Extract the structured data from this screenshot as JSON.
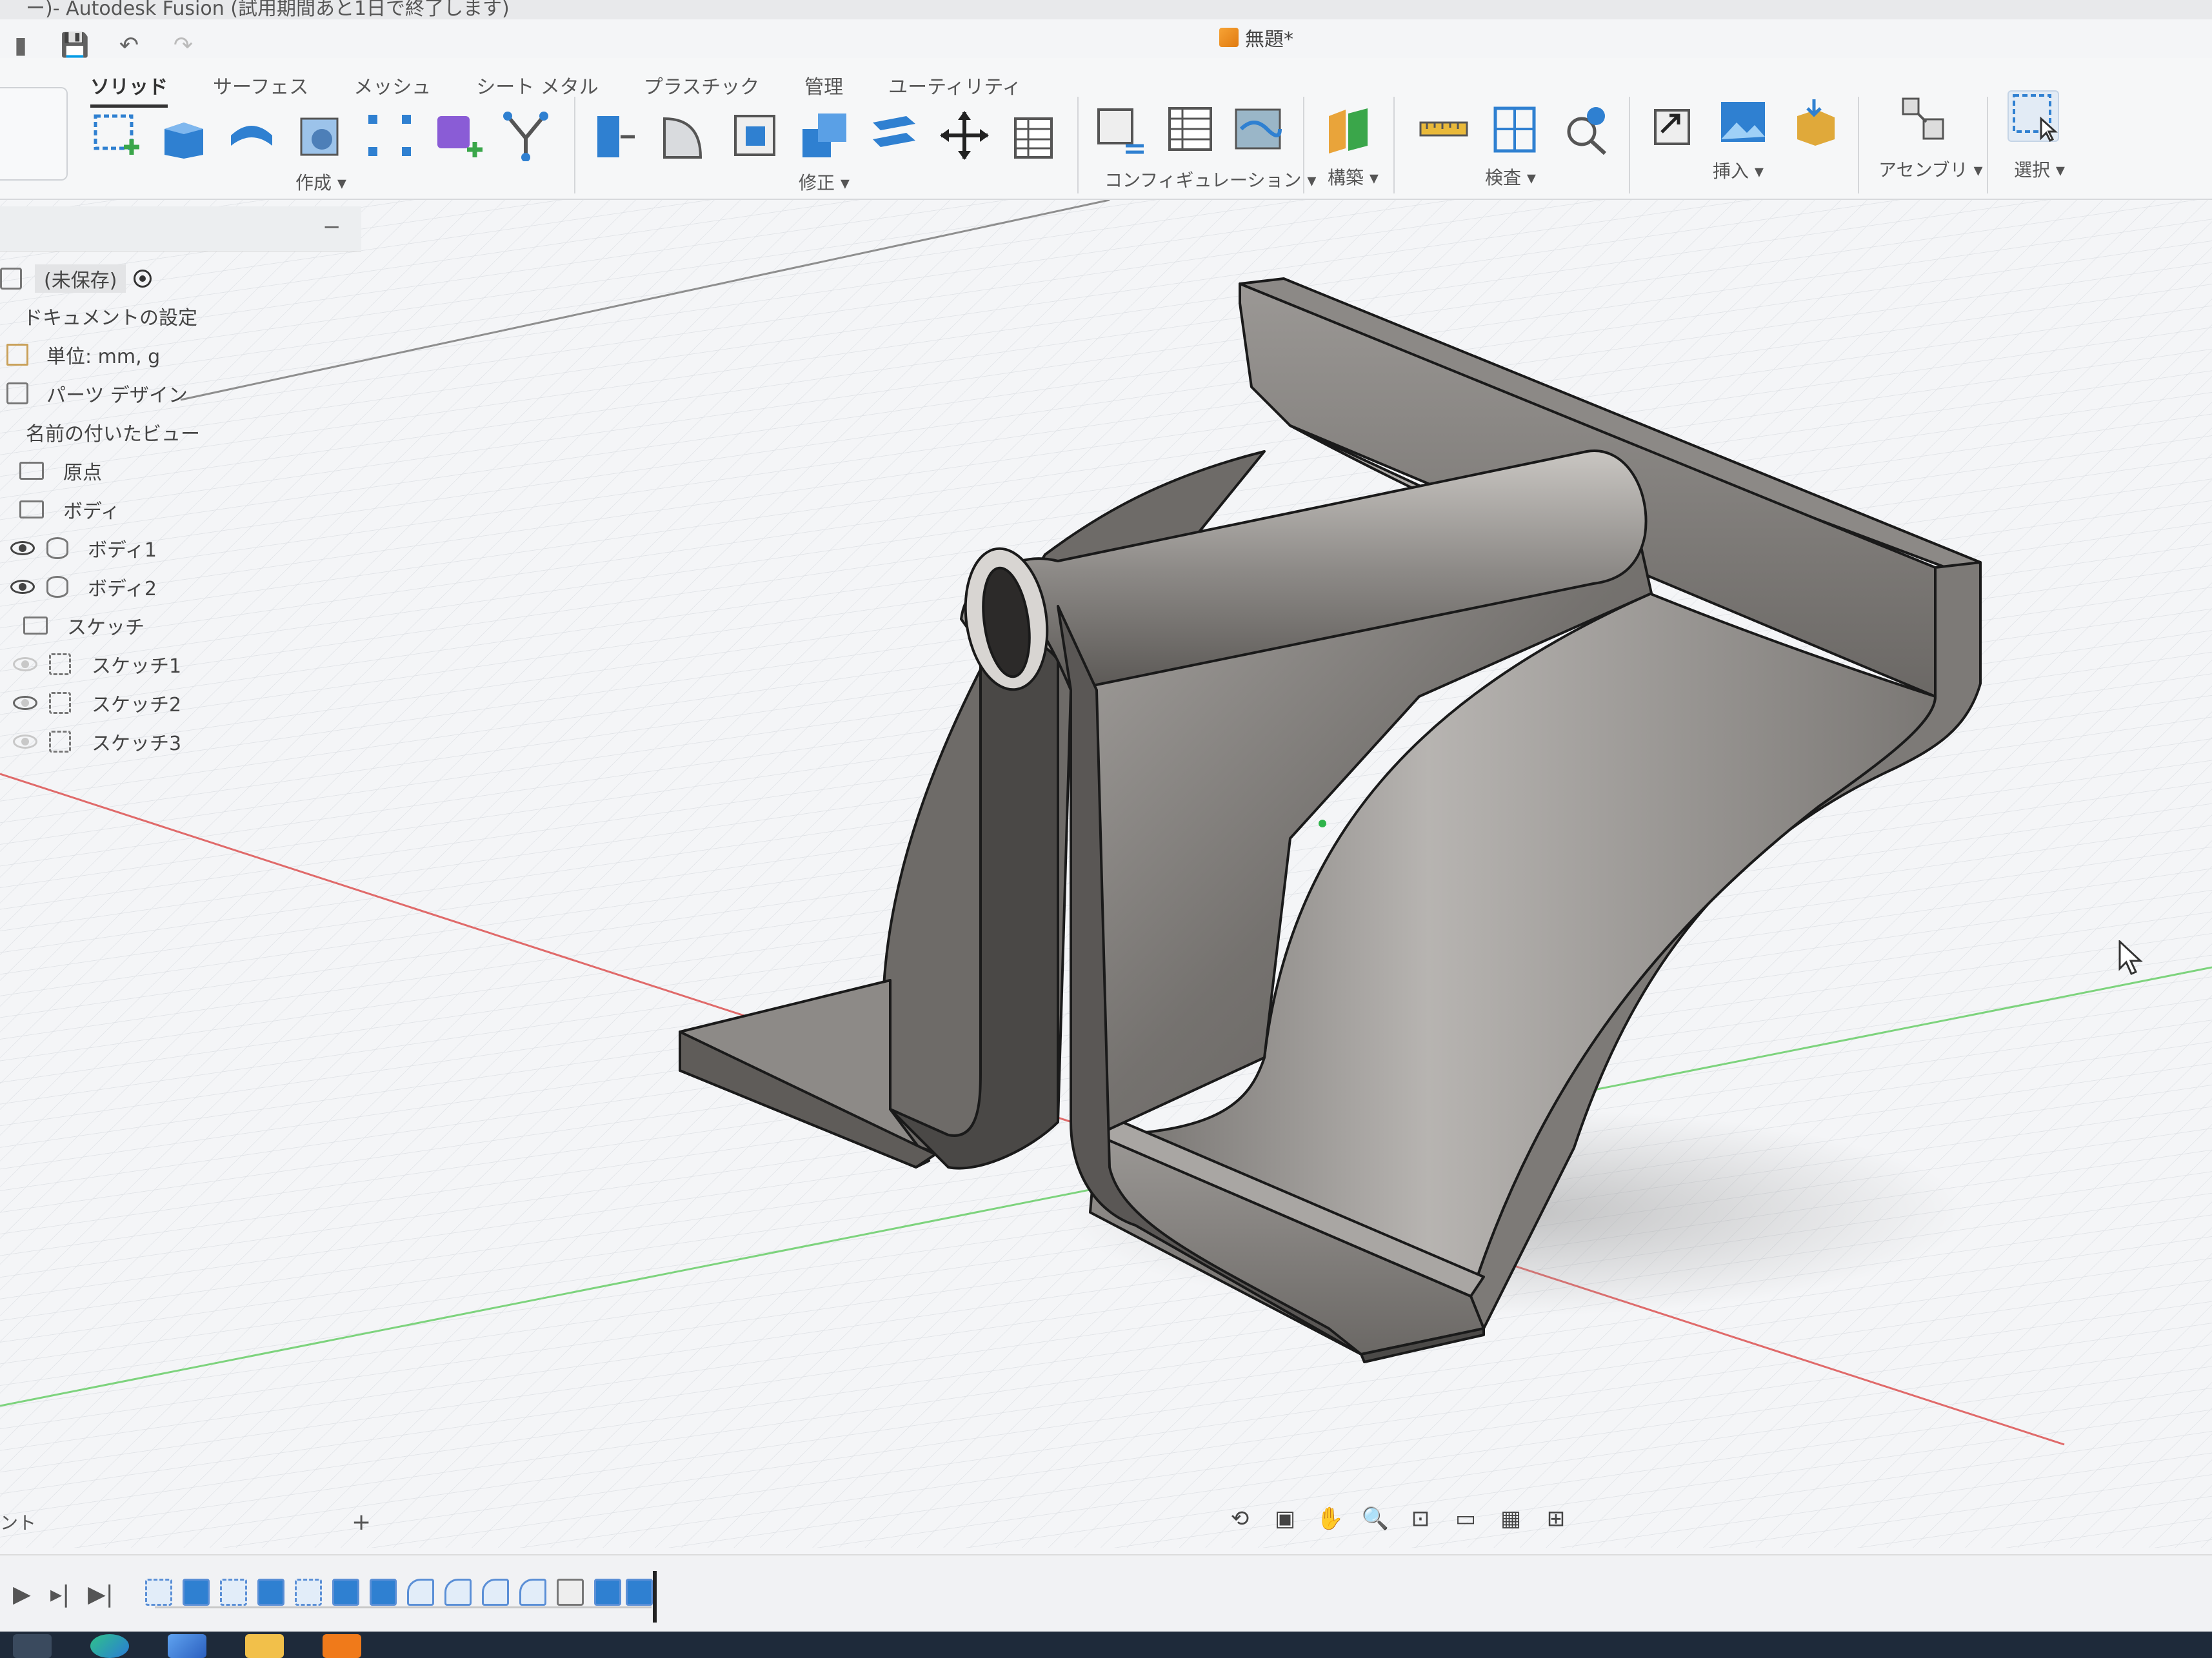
{
  "window": {
    "app_title": "ー)- Autodesk Fusion (試用期間あと1日で終了します)",
    "doc_title": "無題*"
  },
  "ribbon": {
    "tabs": [
      "ソリッド",
      "サーフェス",
      "メッシュ",
      "シート メタル",
      "プラスチック",
      "管理",
      "ユーティリティ"
    ],
    "groups": {
      "create": "作成 ▾",
      "modify": "修正 ▾",
      "configuration": "コンフィギュレーション ▾",
      "construct": "構築 ▾",
      "inspect": "検査 ▾",
      "insert": "挿入 ▾",
      "assemble": "アセンブリ ▾",
      "select": "選択 ▾"
    }
  },
  "browser": {
    "collapse": "−",
    "root": "(未保存)",
    "rows": {
      "doc_settings": "ドキュメントの設定",
      "units": "単位: mm, g",
      "part_design": "パーツ デザイン",
      "named_views": "名前の付いたビュー",
      "origin": "原点",
      "bodies": "ボディ",
      "body1": "ボディ1",
      "body2": "ボディ2",
      "sketches": "スケッチ",
      "sketch1": "スケッチ1",
      "sketch2": "スケッチ2",
      "sketch3": "スケッチ3"
    }
  },
  "comments": {
    "label": "ント",
    "add": "+"
  },
  "colors": {
    "ribbon_blue": "#2f80d1",
    "accent_purple": "#8a5cd6",
    "accent_green": "#3aa64a",
    "model_gray": "#8a8784",
    "axis_red": "#e06a6a",
    "axis_green": "#7dd37d"
  }
}
